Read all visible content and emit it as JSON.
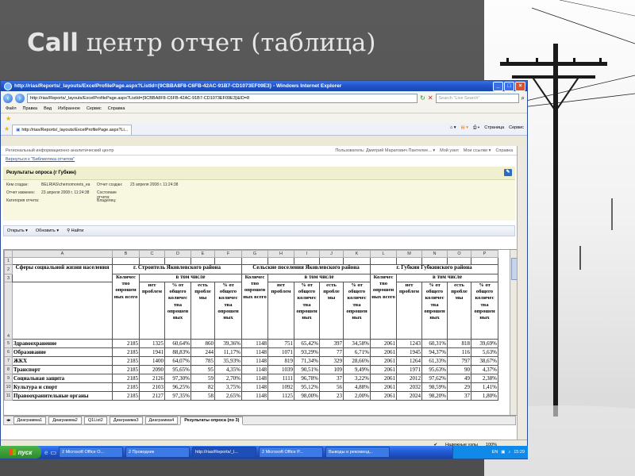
{
  "slide": {
    "title_latin": "Call",
    "title_rest": " центр отчет (таблица)"
  },
  "window": {
    "title": "http://rias/Reports/_layouts/ExcelProfilePage.aspx?ListId={9CBBA8F8-C6FB-42AC-91B7-CD1073EF09E3} - Windows Internet Explorer",
    "address": "http://rias/Reports/_layouts/ExcelProfilePage.aspx?ListId={9CBBA8F8-C6FB-42AC-91B7-CD1073EF09E3}&ID=8",
    "search_placeholder": "Search \"Live Search\"",
    "menu": [
      "Файл",
      "Правка",
      "Вид",
      "Избранное",
      "Сервис",
      "Справка"
    ],
    "tab_label": "http://rias/Reports/_layouts/ExcelProfilePage.aspx?Li...",
    "tools": [
      "Страница",
      "Сервис"
    ]
  },
  "sharepoint": {
    "site_title": "Региональный информационно аналитический центр",
    "user": "Пользователь: Дмитрий Маратович Пантелее... ▾",
    "my_site": "Мой узел",
    "my_links": "Мои ссылки ▾",
    "help": "Справка",
    "back_link": "Вернуться к \"Библиотека отчетов\"",
    "header": "Результаты опроса (г Губкин)",
    "meta": [
      {
        "k": "Кем создан:",
        "v": "BELRIAS\\chernomorets_ea",
        "k2": "Отчет создан:",
        "v2": "23 апреля 2008 г. 11:24:38"
      },
      {
        "k": "Отчет изменен:",
        "v": "23 апреля 2008 г. 11:24:38",
        "k2": "Состояние отчета:",
        "v2": ""
      },
      {
        "k": "Категория отчета:",
        "v": "",
        "k2": "Владелец:",
        "v2": ""
      }
    ],
    "toolbar": {
      "open": "Открыть ▾",
      "refresh": "Обновить ▾",
      "find": "Найти"
    }
  },
  "sheet": {
    "col_letters": [
      "A",
      "B",
      "C",
      "D",
      "E",
      "F",
      "G",
      "H",
      "I",
      "J",
      "K",
      "L",
      "M",
      "N",
      "O",
      "P"
    ],
    "title_left": "Сферы социальной жизни населения",
    "group1": "г. Строитель Яковлевского района",
    "group2": "Сельские поселения Яковлевского района",
    "group3": "г. Губкин Губкинского района",
    "col_total": "Количес тво опрошен ных всего",
    "incl": "в том числе",
    "sub_no": "нет проблем",
    "sub_pct_no": "% от общего количес тва опрошен ных",
    "sub_yes": "есть пробле мы",
    "sub_pct_yes": "% от общего количес тва опрошен ных",
    "rows": [
      {
        "n": "5",
        "name": "Здравоохранение",
        "v": [
          "2185",
          "1325",
          "60,64%",
          "860",
          "39,36%",
          "1148",
          "751",
          "65,42%",
          "397",
          "34,58%",
          "2061",
          "1243",
          "60,31%",
          "818",
          "39,69%"
        ]
      },
      {
        "n": "6",
        "name": "Образование",
        "v": [
          "2185",
          "1941",
          "88,83%",
          "244",
          "11,17%",
          "1148",
          "1071",
          "93,29%",
          "77",
          "6,71%",
          "2061",
          "1945",
          "94,37%",
          "116",
          "5,63%"
        ]
      },
      {
        "n": "7",
        "name": "ЖКХ",
        "v": [
          "2185",
          "1400",
          "64,07%",
          "785",
          "35,93%",
          "1148",
          "819",
          "71,34%",
          "329",
          "28,66%",
          "2061",
          "1264",
          "61,33%",
          "797",
          "38,67%"
        ]
      },
      {
        "n": "8",
        "name": "Транспорт",
        "v": [
          "2185",
          "2090",
          "95,65%",
          "95",
          "4,35%",
          "1148",
          "1039",
          "90,51%",
          "109",
          "9,49%",
          "2061",
          "1971",
          "95,63%",
          "90",
          "4,37%"
        ]
      },
      {
        "n": "9",
        "name": "Социальная защита",
        "v": [
          "2185",
          "2126",
          "97,30%",
          "59",
          "2,70%",
          "1148",
          "1111",
          "96,78%",
          "37",
          "3,22%",
          "2061",
          "2012",
          "97,62%",
          "49",
          "2,38%"
        ]
      },
      {
        "n": "10",
        "name": "Культура и спорт",
        "v": [
          "2185",
          "2103",
          "96,25%",
          "82",
          "3,75%",
          "1148",
          "1092",
          "95,12%",
          "56",
          "4,88%",
          "2061",
          "2032",
          "98,59%",
          "29",
          "1,41%"
        ]
      },
      {
        "n": "11",
        "name": "Правоохранительные органы",
        "v": [
          "2185",
          "2127",
          "97,35%",
          "58",
          "2,65%",
          "1148",
          "1125",
          "98,00%",
          "23",
          "2,00%",
          "2061",
          "2024",
          "98,20%",
          "37",
          "1,80%"
        ]
      }
    ],
    "tabs": [
      "Диаграмма1",
      "Диаграмма2",
      "Q1List2",
      "Диаграмма3",
      "Диаграмма4",
      "Результаты опроса (по 3)"
    ]
  },
  "status": {
    "zone": "Надежные узлы",
    "zoom": "100%"
  },
  "taskbar": {
    "start": "пуск",
    "tasks": [
      "2 Microsoft Office O...",
      "2 Проводник",
      "http://rias/Reports/_l...",
      "2 Microsoft Office P...",
      "Выводы и рекоменд..."
    ],
    "lang": "EN",
    "clock": "15:29"
  },
  "colors": {
    "accent": "#1f55c9",
    "sheet_header": "#e4e4e4",
    "sp_header": "#f0f0d0"
  }
}
